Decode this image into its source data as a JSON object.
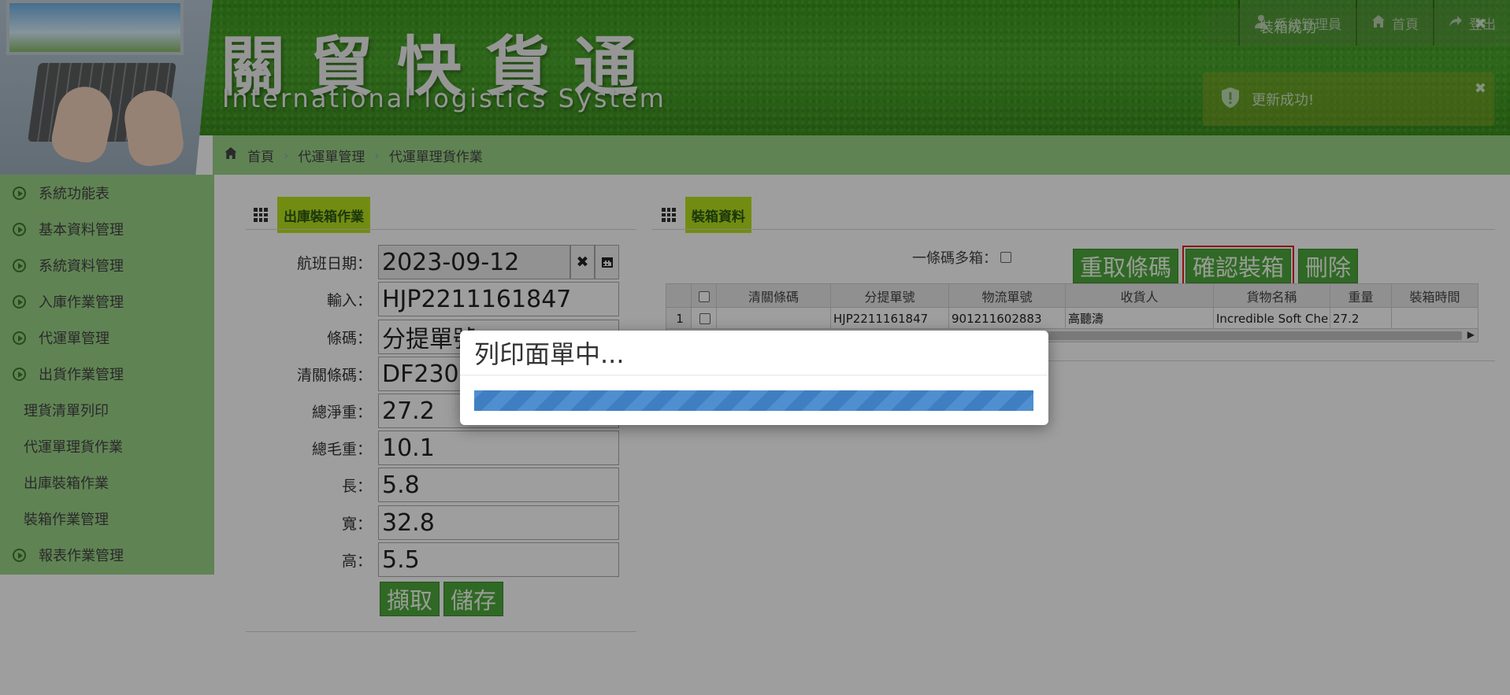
{
  "header": {
    "brand_title": "關貿快貨通",
    "brand_subtitle": "International logistics System",
    "nav": [
      {
        "label": "系統管理員",
        "icon": "user-icon"
      },
      {
        "label": "首頁",
        "icon": "home-icon"
      },
      {
        "label": "登出",
        "icon": "logout-icon"
      }
    ],
    "toasts": [
      {
        "text": "裝箱成功"
      },
      {
        "text": "更新成功!"
      }
    ]
  },
  "breadcrumb": [
    "首頁",
    "代運單管理",
    "代運單理貨作業"
  ],
  "sidebar": {
    "items": [
      {
        "label": "系統功能表",
        "type": "group"
      },
      {
        "label": "基本資料管理",
        "type": "group"
      },
      {
        "label": "系統資料管理",
        "type": "group"
      },
      {
        "label": "入庫作業管理",
        "type": "group"
      },
      {
        "label": "代運單管理",
        "type": "group"
      },
      {
        "label": "出貨作業管理",
        "type": "group"
      },
      {
        "label": "理貨清單列印",
        "type": "sub"
      },
      {
        "label": "代運單理貨作業",
        "type": "sub"
      },
      {
        "label": "出庫裝箱作業",
        "type": "sub"
      },
      {
        "label": "裝箱作業管理",
        "type": "sub"
      },
      {
        "label": "報表作業管理",
        "type": "group"
      }
    ]
  },
  "left_panel": {
    "title": "出庫裝箱作業",
    "fields": [
      {
        "label": "航班日期：",
        "value": "2023-09-12"
      },
      {
        "label": "輸入：",
        "value": "HJP2211161847"
      },
      {
        "label": "條碼：",
        "value": "分提單號"
      },
      {
        "label": "清關條碼：",
        "value": "DF2309"
      },
      {
        "label": "總淨重：",
        "value": "27.2"
      },
      {
        "label": "總毛重：",
        "value": "10.1"
      },
      {
        "label": "長：",
        "value": "5.8"
      },
      {
        "label": "寬：",
        "value": "32.8"
      },
      {
        "label": "高：",
        "value": "5.5"
      }
    ],
    "buttons": {
      "fetch": "擷取",
      "save": "儲存"
    }
  },
  "right_panel": {
    "title": "裝箱資料",
    "multi_box_label": "一條碼多箱：",
    "buttons": {
      "refetch": "重取條碼",
      "confirm": "確認裝箱",
      "delete": "刪除"
    },
    "table": {
      "columns": [
        "",
        "",
        "清關條碼",
        "分提單號",
        "物流單號",
        "收貨人",
        "貨物名稱",
        "重量",
        "裝箱時間"
      ],
      "rows": [
        {
          "no": "1",
          "customs": "",
          "sub_bill": "HJP2211161847",
          "logistics": "901211602883",
          "receiver": "高聽濤",
          "goods": "Incredible Soft Che",
          "weight": "27.2",
          "time": ""
        }
      ]
    }
  },
  "modal": {
    "title": "列印面單中...",
    "progress_percent": 100
  },
  "colors": {
    "sidebar_bg": "#9bd388",
    "title_highlight": "#b8e21c",
    "button_green": "#4ea83c",
    "progress_blue": "#4f8fd0",
    "confirm_border": "#e02020"
  }
}
